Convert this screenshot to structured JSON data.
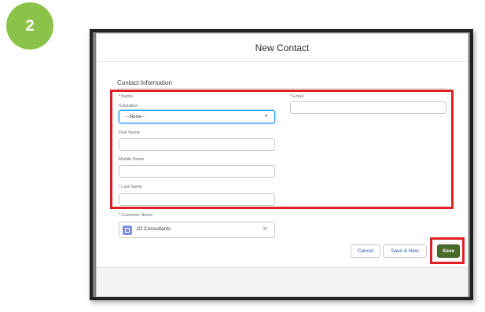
{
  "step": {
    "number": "2"
  },
  "modal": {
    "title": "New Contact",
    "section_title": "Contact Information",
    "fields": {
      "name_label": "Name",
      "salutation_label": "Salutation",
      "salutation_value": "--None--",
      "first_name_label": "First Name",
      "middle_name_label": "Middle Name",
      "last_name_label": "Last Name",
      "email_label": "Email",
      "customer_name_label": "Customer Name",
      "customer_name_value": "JO Consultants"
    },
    "required_marker": "*",
    "buttons": {
      "cancel": "Cancel",
      "save_new": "Save & New",
      "save": "Save"
    }
  },
  "icons": {
    "dropdown": "chevron-down-icon",
    "lookup": "account-icon",
    "clear": "close-icon"
  },
  "colors": {
    "step_badge": "#8bc34a",
    "highlight": "#e02020",
    "save_button": "#4a6b2a",
    "focus": "#1b96ff"
  }
}
